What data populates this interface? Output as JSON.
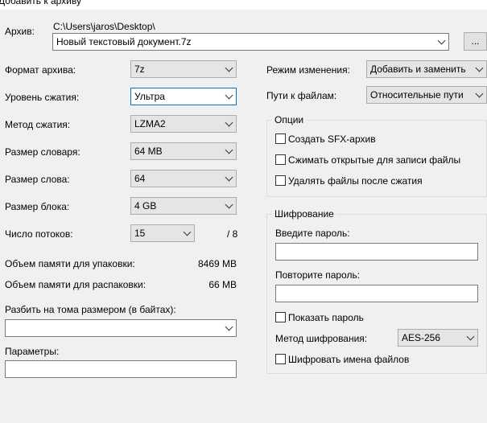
{
  "window": {
    "title": "Добавить к архиву"
  },
  "archive": {
    "label": "Архив:",
    "path": "C:\\Users\\jaros\\Desktop\\",
    "filename": "Новый текстовый документ.7z",
    "browse_label": "..."
  },
  "left": {
    "format": {
      "label": "Формат архива:",
      "value": "7z"
    },
    "level": {
      "label": "Уровень сжатия:",
      "value": "Ультра"
    },
    "method": {
      "label": "Метод сжатия:",
      "value": "LZMA2"
    },
    "dict": {
      "label": "Размер словаря:",
      "value": "64 MB"
    },
    "word": {
      "label": "Размер слова:",
      "value": "64"
    },
    "block": {
      "label": "Размер блока:",
      "value": "4 GB"
    },
    "threads": {
      "label": "Число потоков:",
      "value": "15",
      "max": "/ 8"
    },
    "mem_pack": {
      "label": "Объем памяти для упаковки:",
      "value": "8469 MB"
    },
    "mem_unpack": {
      "label": "Объем памяти для распаковки:",
      "value": "66 MB"
    },
    "split": {
      "label": "Разбить на тома размером (в байтах):",
      "value": ""
    },
    "params": {
      "label": "Параметры:",
      "value": ""
    }
  },
  "right": {
    "update": {
      "label": "Режим изменения:",
      "value": "Добавить и заменить"
    },
    "paths": {
      "label": "Пути к файлам:",
      "value": "Относительные пути"
    },
    "options": {
      "title": "Опции",
      "sfx": "Создать SFX-архив",
      "shared": "Сжимать открытые для записи файлы",
      "delete": "Удалять файлы после сжатия"
    },
    "encryption": {
      "title": "Шифрование",
      "password_label": "Введите пароль:",
      "repeat_label": "Повторите пароль:",
      "show_password": "Показать пароль",
      "method_label": "Метод шифрования:",
      "method_value": "AES-256",
      "encrypt_names": "Шифровать имена файлов"
    }
  }
}
